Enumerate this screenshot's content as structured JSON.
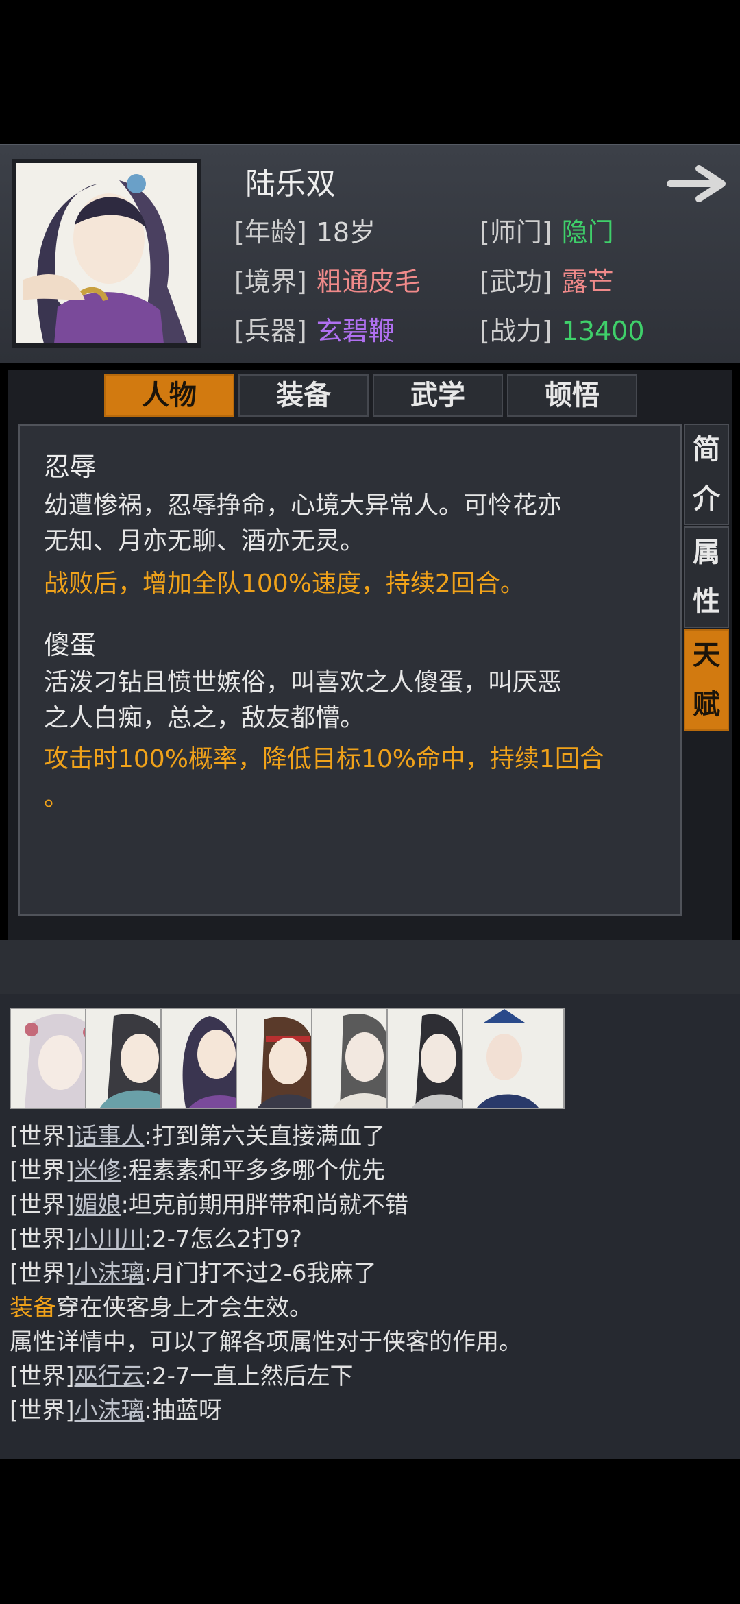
{
  "hero": {
    "name": "陆乐双",
    "attrs": {
      "age_label": "[年龄]",
      "age": "18岁",
      "school_label": "[师门]",
      "school": "隐门",
      "realm_label": "[境界]",
      "realm": "粗通皮毛",
      "martial_label": "[武功]",
      "martial": "露芒",
      "weapon_label": "[兵器]",
      "weapon": "玄碧鞭",
      "power_label": "[战力]",
      "power": "13400"
    },
    "colors": {
      "school": "#3fd06a",
      "realm": "#f08a8a",
      "martial": "#f08a8a",
      "weapon": "#b070f0",
      "power": "#3fd06a"
    }
  },
  "tabs": [
    "人物",
    "装备",
    "武学",
    "顿悟"
  ],
  "side_tabs": [
    "简介",
    "属性",
    "天赋"
  ],
  "traits": [
    {
      "name": "忍辱",
      "desc_lines": [
        "幼遭惨祸，忍辱挣命，心境大异常人。可怜花亦",
        "无知、月亦无聊、酒亦无灵。"
      ],
      "effect_lines": [
        "战败后，增加全队100%速度，持续2回合。"
      ]
    },
    {
      "name": "傻蛋",
      "desc_lines": [
        "活泼刁钻且愤世嫉俗，叫喜欢之人傻蛋，叫厌恶",
        "之人白痴，总之，敌友都懵。"
      ],
      "effect_lines": [
        "攻击时100%概率，降低目标10%命中，持续1回合",
        "。"
      ]
    }
  ],
  "chat": [
    {
      "channel": "[世界]",
      "user": "话事人",
      "text": ":打到第六关直接满血了"
    },
    {
      "channel": "[世界]",
      "user": "米修",
      "text": ":程素素和平多多哪个优先"
    },
    {
      "channel": "[世界]",
      "user": "媚娘",
      "text": ":坦克前期用胖带和尚就不错"
    },
    {
      "channel": "[世界]",
      "user": "小川川",
      "text": ":2-7怎么2打9?"
    },
    {
      "channel": "[世界]",
      "user": "小沫璃",
      "text": ":月门打不过2-6我麻了"
    },
    {
      "highlight": "装备",
      "text": "穿在侠客身上才会生效。"
    },
    {
      "text": "属性详情中，可以了解各项属性对于侠客的作用。"
    },
    {
      "channel": "[世界]",
      "user": "巫行云",
      "text": ":2-7一直上然后左下"
    },
    {
      "channel": "[世界]",
      "user": "小沫璃",
      "text": ":抽蓝呀"
    }
  ],
  "accent": "#d27a10"
}
